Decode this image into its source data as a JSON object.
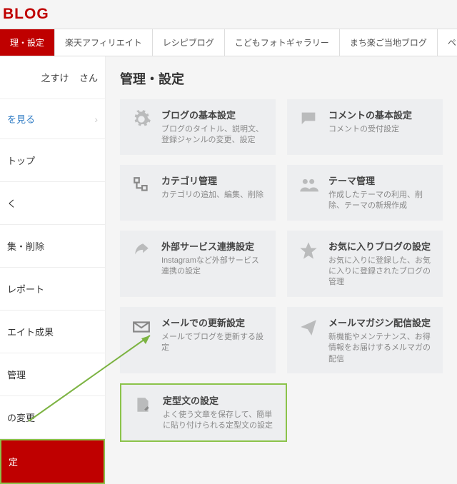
{
  "logo": "BLOG",
  "tabs": {
    "active": "理・設定",
    "t1": "楽天アフィリエイト",
    "t2": "レシピブログ",
    "t3": "こどもフォトギャラリー",
    "t4": "まち楽ご当地ブログ",
    "t5": "ペット"
  },
  "user": {
    "name": "之すけ",
    "suffix": "さん"
  },
  "viewBlog": "を見る",
  "menu": {
    "m1": "トップ",
    "m2": "く",
    "m3": "集・削除",
    "m4": "レポート",
    "m5": "エイト成果",
    "m6": "管理",
    "m7": "の変更",
    "m8": "定"
  },
  "page": {
    "title": "管理・設定"
  },
  "cards": {
    "c1": {
      "t": "ブログの基本設定",
      "d": "ブログのタイトル、説明文、登録ジャンルの変更、設定"
    },
    "c2": {
      "t": "コメントの基本設定",
      "d": "コメントの受付設定"
    },
    "c3": {
      "t": "カテゴリ管理",
      "d": "カテゴリの追加、編集、削除"
    },
    "c4": {
      "t": "テーマ管理",
      "d": "作成したテーマの利用、削除、テーマの新規作成"
    },
    "c5": {
      "t": "外部サービス連携設定",
      "d": "Instagramなど外部サービス連携の設定"
    },
    "c6": {
      "t": "お気に入りブログの設定",
      "d": "お気に入りに登録した、お気に入りに登録されたブログの管理"
    },
    "c7": {
      "t": "メールでの更新設定",
      "d": "メールでブログを更新する設定"
    },
    "c8": {
      "t": "メールマガジン配信設定",
      "d": "新機能やメンテナンス、お得情報をお届けするメルマガの配信"
    },
    "c9": {
      "t": "定型文の設定",
      "d": "よく使う文章を保存して、簡単に貼り付けられる定型文の設定"
    }
  }
}
